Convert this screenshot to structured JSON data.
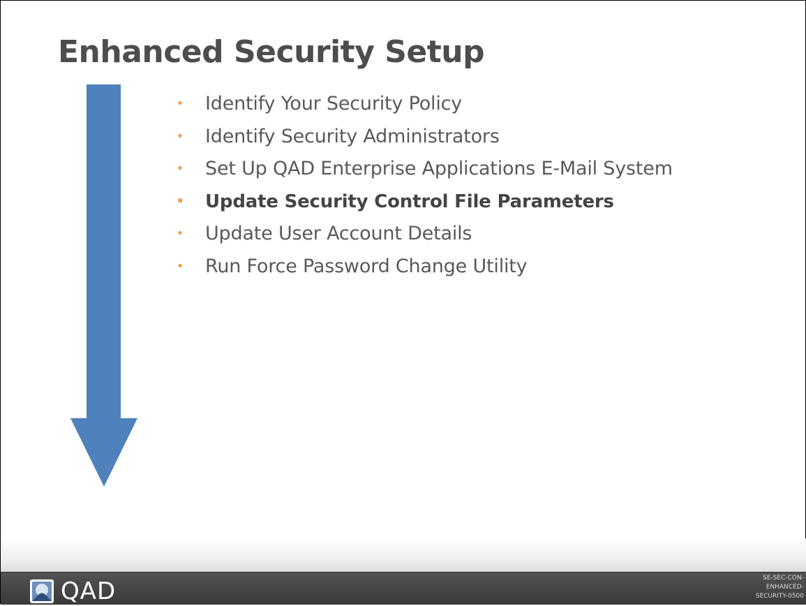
{
  "slide": {
    "title": "Enhanced Security Setup",
    "bullets": [
      {
        "text": "Identify Your Security Policy",
        "bold": false
      },
      {
        "text": "Identify Security Administrators",
        "bold": false
      },
      {
        "text": "Set Up QAD Enterprise Applications E-Mail System",
        "bold": false
      },
      {
        "text": "Update Security Control File Parameters",
        "bold": true
      },
      {
        "text": "Update User Account Details",
        "bold": false
      },
      {
        "text": "Run Force Password Change Utility",
        "bold": false
      }
    ],
    "bullet_glyph": "•",
    "arrow_icon": "arrow-down-icon"
  },
  "footer": {
    "logo_text": "QAD",
    "doc_code_lines": [
      "SE-SEC-CON-",
      "ENHANCED-",
      "SECURITY-0500"
    ]
  },
  "colors": {
    "title": "#4d4d4d",
    "bullet_text": "#595959",
    "bullet_dot": "#f39a4d",
    "arrow": "#4f81bd",
    "footer_bg": "#444444"
  }
}
